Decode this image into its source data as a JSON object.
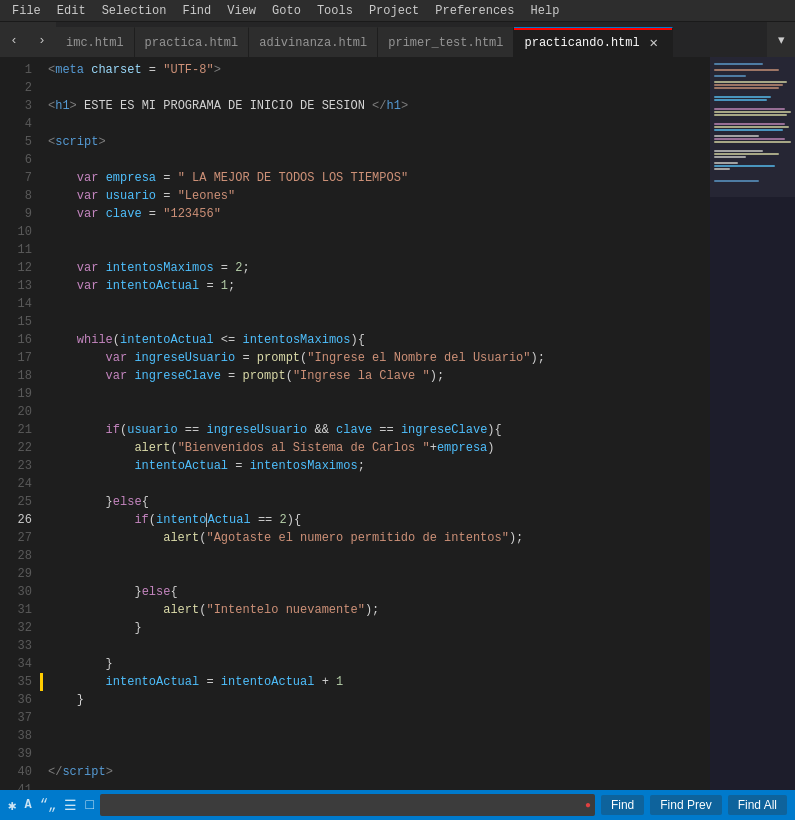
{
  "menubar": {
    "items": [
      "File",
      "Edit",
      "Selection",
      "Find",
      "View",
      "Goto",
      "Tools",
      "Project",
      "Preferences",
      "Help"
    ]
  },
  "tabs": [
    {
      "id": "imc",
      "label": "imc.html",
      "active": false,
      "closable": false
    },
    {
      "id": "practica",
      "label": "practica.html",
      "active": false,
      "closable": false
    },
    {
      "id": "adivinanza",
      "label": "adivinanza.html",
      "active": false,
      "closable": false
    },
    {
      "id": "primer_test",
      "label": "primer_test.html",
      "active": false,
      "closable": false
    },
    {
      "id": "practicando",
      "label": "practicando.html",
      "active": true,
      "closable": true
    }
  ],
  "find_bar": {
    "find_label": "Find",
    "find_prev_label": "Find Prev",
    "find_all_label": "Find All",
    "input_placeholder": ""
  },
  "colors": {
    "active_tab_indicator": "#ff0000",
    "find_bar_bg": "#007acc",
    "accent": "#007acc"
  }
}
